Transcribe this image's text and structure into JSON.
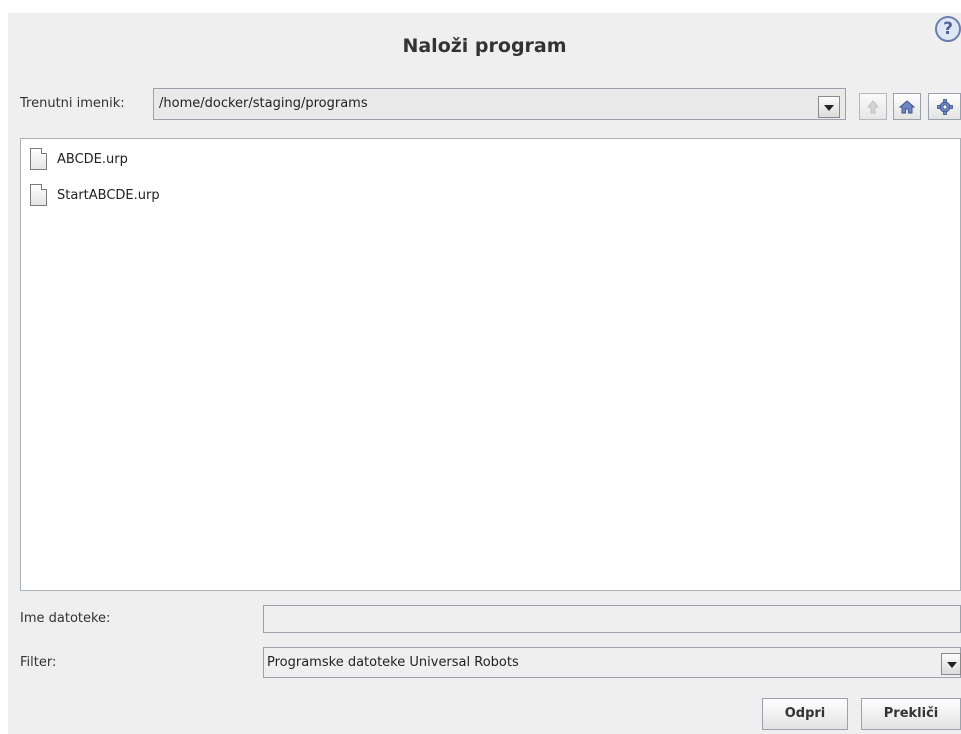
{
  "dialog": {
    "title": "Naloži program",
    "help_icon": "help-icon"
  },
  "directory": {
    "label": "Trenutni imenik:",
    "value": "/home/docker/staging/programs",
    "dropdown_icon": "chevron-down-icon"
  },
  "toolbar": {
    "up_icon": "up-arrow-icon",
    "home_icon": "home-icon",
    "settings_icon": "gear-icon"
  },
  "files": [
    {
      "name": "ABCDE.urp",
      "icon": "file-icon"
    },
    {
      "name": "StartABCDE.urp",
      "icon": "file-icon"
    }
  ],
  "filename": {
    "label": "Ime datoteke:",
    "value": ""
  },
  "filter": {
    "label": "Filter:",
    "value": "Programske datoteke Universal Robots",
    "dropdown_icon": "chevron-down-icon"
  },
  "buttons": {
    "open": "Odpri",
    "cancel": "Prekliči"
  },
  "colors": {
    "background": "#efefef",
    "list_background": "#ffffff",
    "border": "#9aa3ad",
    "icon_blue": "#4e629a"
  }
}
